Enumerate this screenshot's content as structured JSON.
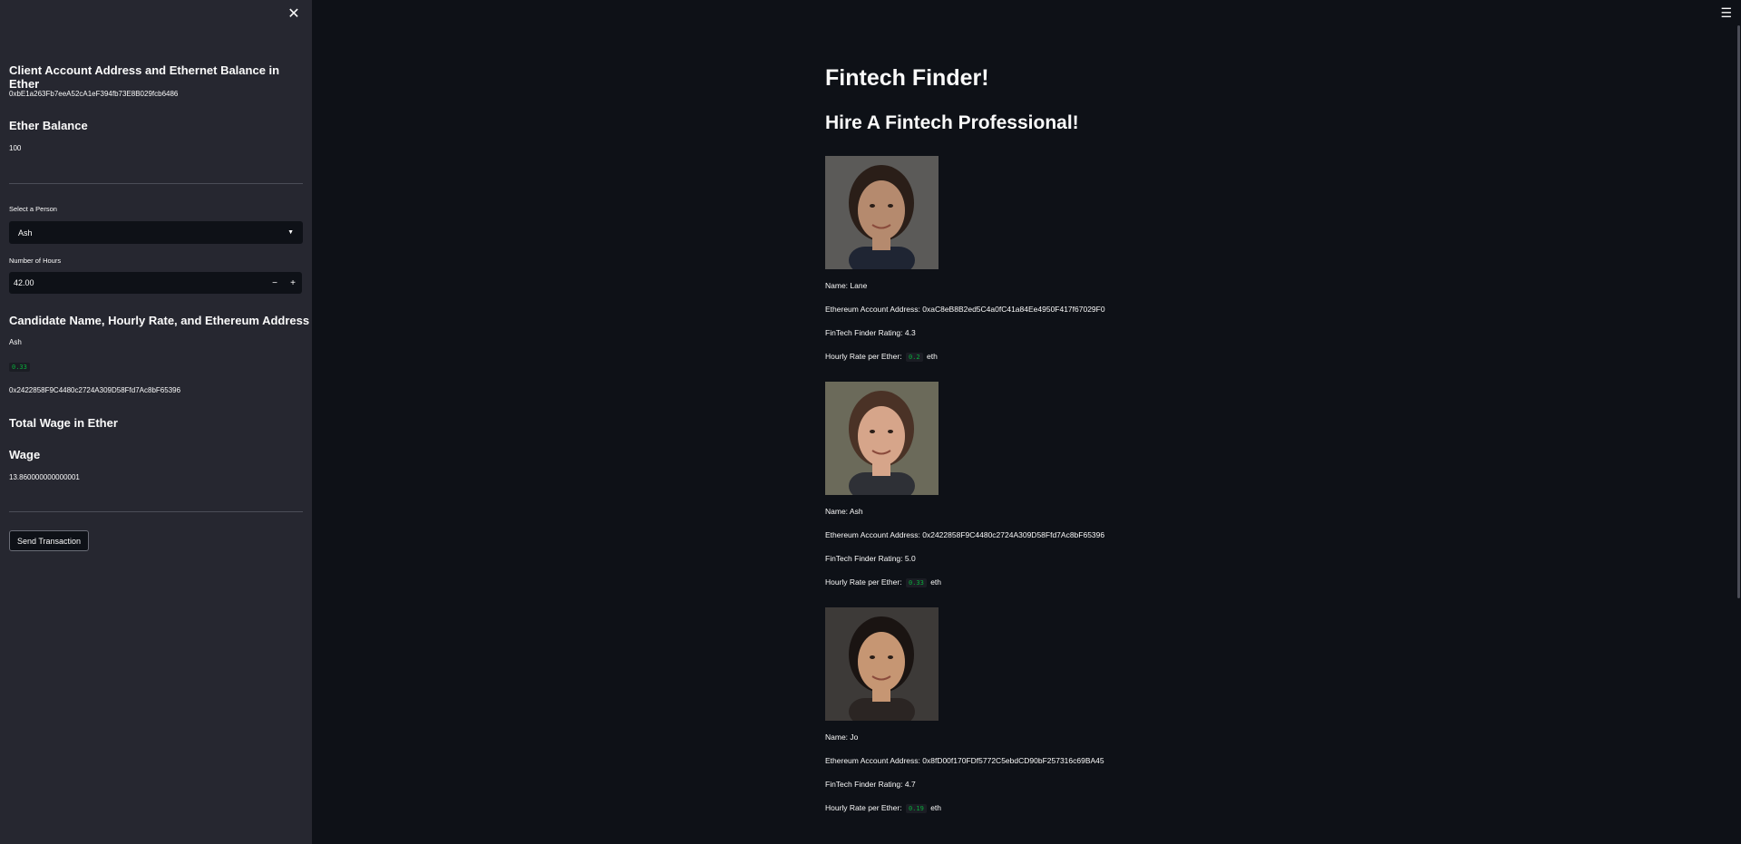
{
  "sidebar": {
    "client_heading": "Client Account Address and Ethernet Balance in Ether",
    "client_address": "0xbE1a263Fb7eeA52cA1eF394fb73E8B029fcb6486",
    "balance_heading": "Ether Balance",
    "balance_value": "100",
    "select_label": "Select a Person",
    "select_value": "Ash",
    "hours_label": "Number of Hours",
    "hours_value": "42.00",
    "candidate_heading": "Candidate Name, Hourly Rate, and Ethereum Address",
    "candidate_name": "Ash",
    "candidate_rate": "0.33",
    "candidate_address": "0x2422858F9C4480c2724A309D58Ffd7Ac8bF65396",
    "total_wage_heading": "Total Wage in Ether",
    "wage_heading": "Wage",
    "wage_value": "13.860000000000001",
    "send_button": "Send Transaction"
  },
  "main": {
    "title": "Fintech Finder!",
    "subtitle": "Hire A Fintech Professional!",
    "candidates": [
      {
        "name_line": "Name: Lane",
        "address_line": "Ethereum Account Address: 0xaC8eB8B2ed5C4a0fC41a84Ee4950F417f67029F0",
        "rating_line": "FinTech Finder Rating: 4.3",
        "rate_prefix": "Hourly Rate per Ether:",
        "rate": "0.2",
        "rate_suffix": "eth",
        "skin": "#b58a6e",
        "hair": "#2a1e18",
        "bg": "#5b5a58",
        "shirt": "#1f2533"
      },
      {
        "name_line": "Name: Ash",
        "address_line": "Ethereum Account Address: 0x2422858F9C4480c2724A309D58Ffd7Ac8bF65396",
        "rating_line": "FinTech Finder Rating: 5.0",
        "rate_prefix": "Hourly Rate per Ether:",
        "rate": "0.33",
        "rate_suffix": "eth",
        "skin": "#d6a58a",
        "hair": "#4a3226",
        "bg": "#6b6a5a",
        "shirt": "#2e3036"
      },
      {
        "name_line": "Name: Jo",
        "address_line": "Ethereum Account Address: 0x8fD00f170FDf5772C5ebdCD90bF257316c69BA45",
        "rating_line": "FinTech Finder Rating: 4.7",
        "rate_prefix": "Hourly Rate per Ether:",
        "rate": "0.19",
        "rate_suffix": "eth",
        "skin": "#c69673",
        "hair": "#1a1412",
        "bg": "#3d3a38",
        "shirt": "#2b2523"
      }
    ]
  }
}
